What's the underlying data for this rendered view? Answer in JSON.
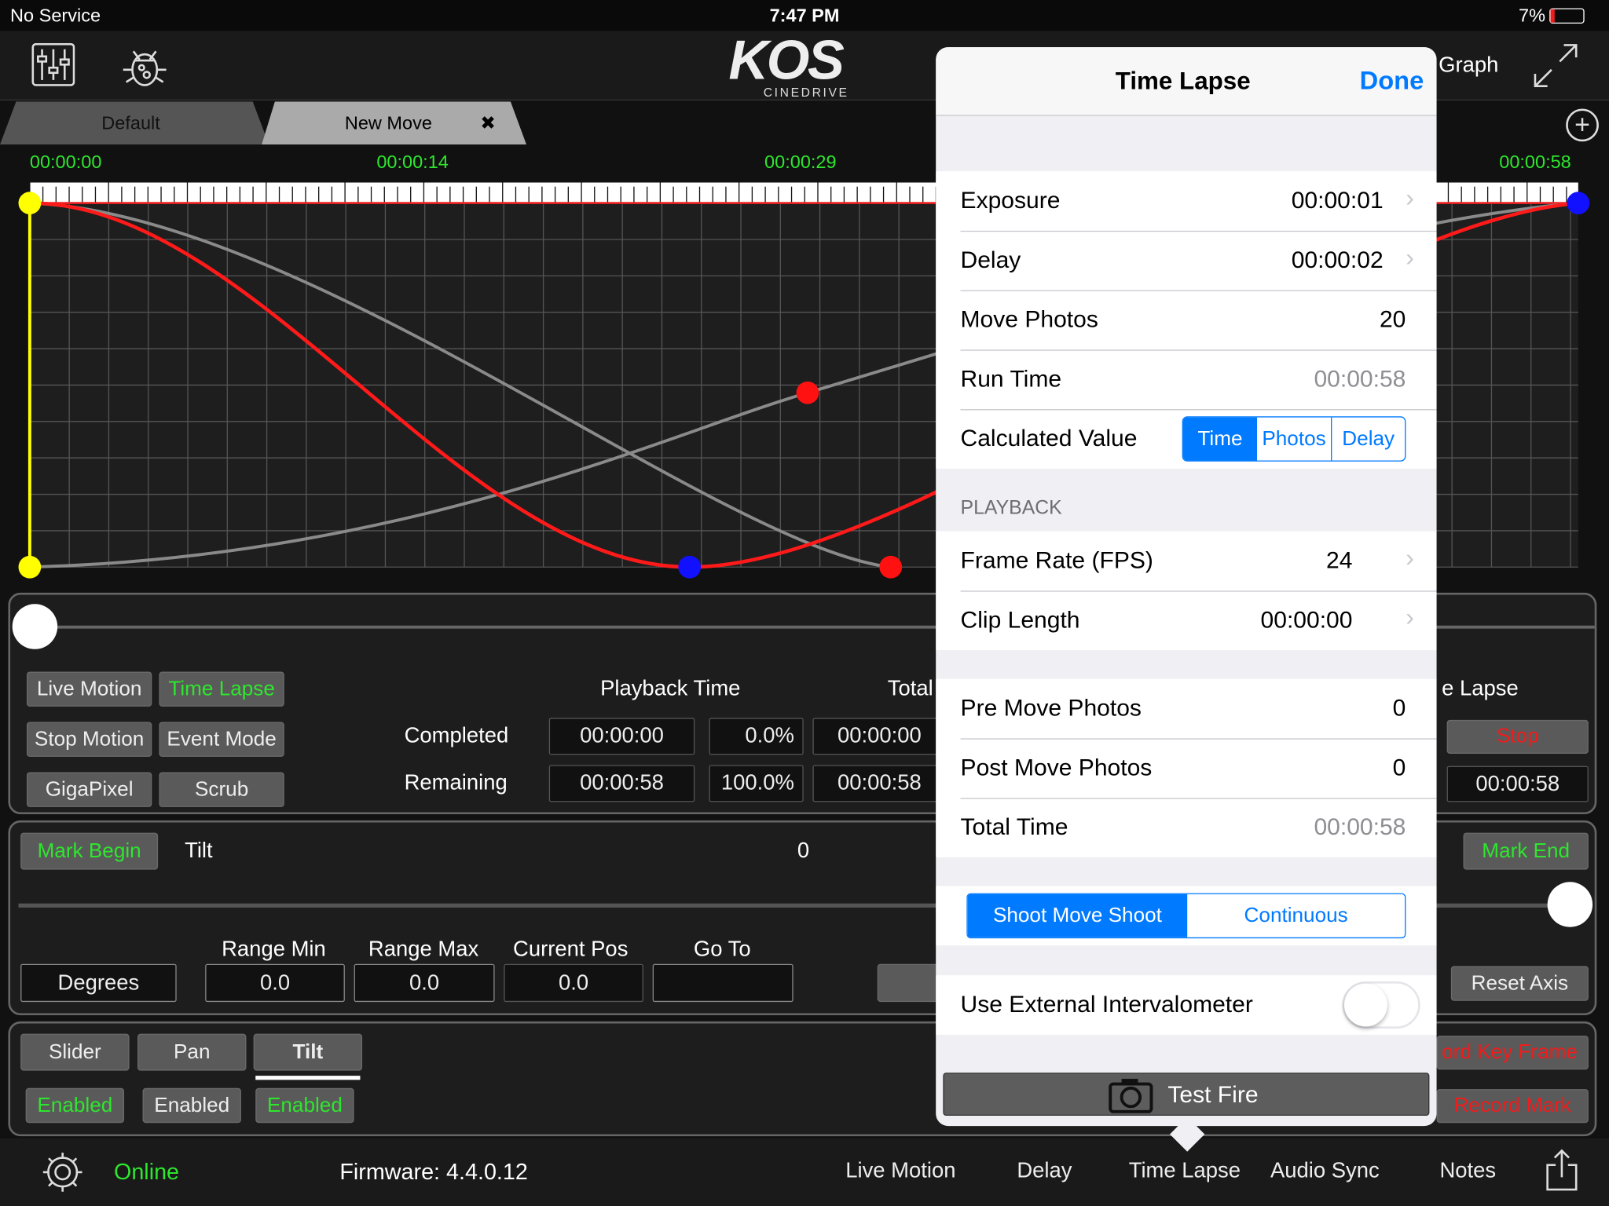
{
  "status_bar": {
    "carrier": "No Service",
    "time": "7:47 PM",
    "battery": "7%"
  },
  "header": {
    "logo": "KOS",
    "logo_sub": "CINEDRIVE",
    "graph_label": "Graph",
    "icons": [
      "sliders-icon",
      "bug-icon",
      "expand-icon",
      "add-icon"
    ]
  },
  "tabs": [
    {
      "label": "Default"
    },
    {
      "label": "New Move",
      "close": "✖"
    }
  ],
  "timeline": {
    "ticks": [
      "00:00:00",
      "00:00:14",
      "00:00:29",
      "00:00:58"
    ]
  },
  "modes": {
    "buttons": [
      "Live Motion",
      "Time Lapse",
      "Stop Motion",
      "Event Mode",
      "GigaPixel",
      "Scrub"
    ],
    "active": "Time Lapse"
  },
  "playback": {
    "header": "Playback Time",
    "total_header": "Total",
    "completed_label": "Completed",
    "remaining_label": "Remaining",
    "completed": [
      "00:00:00",
      "0.0%",
      "00:00:00"
    ],
    "remaining": [
      "00:00:58",
      "100.0%",
      "00:00:58"
    ],
    "right_header": "e Lapse",
    "stop": "Stop",
    "right_time": "00:00:58"
  },
  "axis": {
    "mark_begin": "Mark Begin",
    "name": "Tilt",
    "value": "0",
    "mark_end": "Mark End",
    "unit": "Degrees",
    "range_min_label": "Range Min",
    "range_max_label": "Range Max",
    "current_pos_label": "Current Pos",
    "go_to_label": "Go To",
    "range_min": "0.0",
    "range_max": "0.0",
    "current_pos": "0.0",
    "go_to": "",
    "reset": "Reset Axis"
  },
  "motors": {
    "tabs": [
      "Slider",
      "Pan",
      "Tilt"
    ],
    "selected": "Tilt",
    "enabled": [
      "Enabled",
      "Enabled",
      "Enabled"
    ],
    "record_key_frame": "ord Key Frame",
    "record_mark": "Record Mark"
  },
  "bottom": {
    "status": "Online",
    "firmware": "Firmware: 4.4.0.12",
    "tabs": [
      "Live Motion",
      "Delay",
      "Time Lapse",
      "Audio Sync",
      "Notes"
    ]
  },
  "popover": {
    "title": "Time Lapse",
    "done": "Done",
    "rows": [
      {
        "label": "Exposure",
        "value": "00:00:01"
      },
      {
        "label": "Delay",
        "value": "00:00:02"
      },
      {
        "label": "Move Photos",
        "value": "20"
      },
      {
        "label": "Run Time",
        "value": "00:00:58"
      }
    ],
    "calc_label": "Calculated Value",
    "calc_options": [
      "Time",
      "Photos",
      "Delay"
    ],
    "calc_selected": "Time",
    "playback_section": "PLAYBACK",
    "playback_rows": [
      {
        "label": "Frame Rate (FPS)",
        "value": "24"
      },
      {
        "label": "Clip Length",
        "value": "00:00:00"
      }
    ],
    "extra_rows": [
      {
        "label": "Pre Move Photos",
        "value": "0"
      },
      {
        "label": "Post Move Photos",
        "value": "0"
      },
      {
        "label": "Total Time",
        "value": "00:00:58"
      }
    ],
    "mode_options": [
      "Shoot Move Shoot",
      "Continuous"
    ],
    "mode_selected": "Shoot Move Shoot",
    "ext_label": "Use External Intervalometer",
    "ext_on": false,
    "test_fire": "Test Fire"
  },
  "colors": {
    "accent": "#007aff",
    "green": "#2ee62e",
    "red": "#f01c1c",
    "curve_red": "#ff1a1a",
    "curve_gray": "#8a8a8a"
  }
}
